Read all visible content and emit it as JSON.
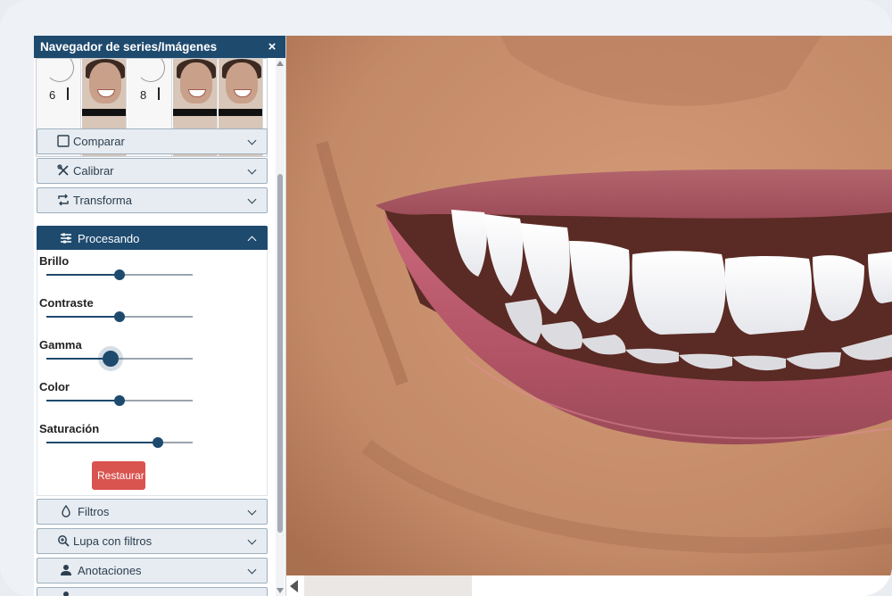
{
  "sidebar": {
    "title": "Navegador de series/Imágenes",
    "close": "×",
    "thumbnails": [
      {
        "kind": "sketch",
        "label": "6"
      },
      {
        "kind": "face"
      },
      {
        "kind": "sketch",
        "label": "8"
      },
      {
        "kind": "face"
      },
      {
        "kind": "face"
      }
    ],
    "sections": {
      "compare": "Comparar",
      "calibrate": "Calibrar",
      "transform": "Transforma",
      "processing": "Procesando",
      "filters": "Filtros",
      "magnifier": "Lupa con filtros",
      "annotations": "Anotaciones"
    },
    "processing": {
      "controls": [
        {
          "label": "Brillo",
          "value": 0.5
        },
        {
          "label": "Contraste",
          "value": 0.5
        },
        {
          "label": "Gamma",
          "value": 0.44
        },
        {
          "label": "Color",
          "value": 0.5
        },
        {
          "label": "Saturación",
          "value": 0.76
        }
      ],
      "restore_label": "Restaurar"
    }
  },
  "colors": {
    "header": "#1e4a6e",
    "accordion_bg": "#e6ecf1",
    "restore": "#d9534f",
    "skin": "#c58f6d",
    "lips": "#b15a66",
    "teeth": "#f4f4f6"
  }
}
